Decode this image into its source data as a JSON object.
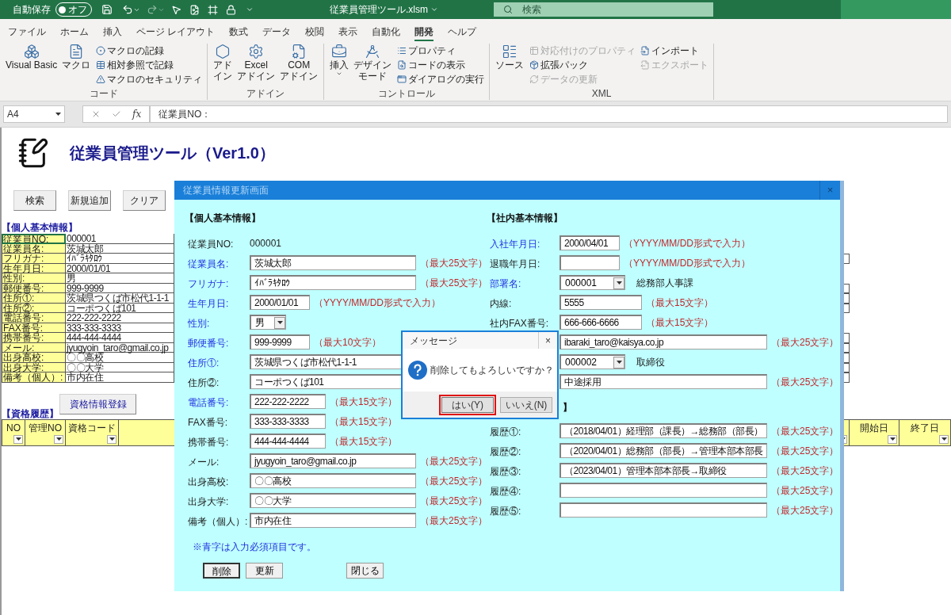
{
  "title_bar": {
    "autosave_label": "自動保存",
    "autosave": {
      "label": "オフ",
      "on": false
    },
    "filename": "従業員管理ツール.xlsm",
    "search_placeholder": "検索"
  },
  "ribbon_tabs": [
    {
      "label": "ファイル",
      "selected": false
    },
    {
      "label": "ホーム",
      "selected": false
    },
    {
      "label": "挿入",
      "selected": false
    },
    {
      "label": "ページ レイアウト",
      "selected": false
    },
    {
      "label": "数式",
      "selected": false
    },
    {
      "label": "データ",
      "selected": false
    },
    {
      "label": "校閲",
      "selected": false
    },
    {
      "label": "表示",
      "selected": false
    },
    {
      "label": "自動化",
      "selected": false
    },
    {
      "label": "開発",
      "selected": true
    },
    {
      "label": "ヘルプ",
      "selected": false
    }
  ],
  "ribbon_groups": [
    {
      "title": "コード",
      "items": [
        {
          "kind": "large",
          "lines": [
            "Visual Basic"
          ]
        },
        {
          "kind": "large",
          "lines": [
            "マクロ"
          ]
        },
        {
          "kind": "stack",
          "items": [
            {
              "label": "マクロの記録",
              "disabled": false
            },
            {
              "label": "相対参照で記録",
              "disabled": false
            },
            {
              "label": "マクロのセキュリティ",
              "disabled": false
            }
          ]
        }
      ]
    },
    {
      "title": "アドイン",
      "items": [
        {
          "kind": "large",
          "lines": [
            "アド",
            "イン"
          ]
        },
        {
          "kind": "large",
          "lines": [
            "Excel",
            "アドイン"
          ]
        },
        {
          "kind": "large",
          "lines": [
            "COM",
            "アドイン"
          ]
        }
      ]
    },
    {
      "title": "コントロール",
      "items": [
        {
          "kind": "large_menu",
          "lines": [
            "挿入"
          ]
        },
        {
          "kind": "large",
          "lines": [
            "デザイン",
            "モード"
          ]
        },
        {
          "kind": "stack",
          "items": [
            {
              "label": "プロパティ",
              "disabled": false
            },
            {
              "label": "コードの表示",
              "disabled": false
            },
            {
              "label": "ダイアログの実行",
              "disabled": false
            }
          ]
        }
      ]
    },
    {
      "title": "XML",
      "items": [
        {
          "kind": "large",
          "lines": [
            "ソース"
          ]
        },
        {
          "kind": "stack",
          "items": [
            {
              "label": "対応付けのプロパティ",
              "disabled": true
            },
            {
              "label": "拡張パック",
              "disabled": false
            },
            {
              "label": "データの更新",
              "disabled": true
            }
          ]
        },
        {
          "kind": "stack",
          "items": [
            {
              "label": "インポート",
              "disabled": false
            },
            {
              "label": "エクスポート",
              "disabled": true
            }
          ]
        }
      ]
    }
  ],
  "formula_bar": {
    "name_box": "A4",
    "fx": "fx",
    "formula": "従業員NO："
  },
  "sheet": {
    "title": "従業員管理ツール（Ver1.0）",
    "buttons": [
      "検索",
      "新規追加",
      "クリア"
    ],
    "personal_title": "【個人基本情報】",
    "personal_rows": [
      {
        "label": "従業員NO:",
        "value": "000001",
        "selected": true
      },
      {
        "label": "従業員名:",
        "value": "茨城太郎",
        "selected": false
      },
      {
        "label": "フリガナ:",
        "value": "ｲﾊﾞﾗｷﾀﾛｳ",
        "selected": false
      },
      {
        "label": "生年月日:",
        "value": "2000/01/01",
        "selected": false
      },
      {
        "label": "性別:",
        "value": "男",
        "selected": false
      },
      {
        "label": "郵便番号:",
        "value": "999-9999",
        "selected": false
      },
      {
        "label": "住所①:",
        "value": "茨城県つくば市松代1-1-1",
        "selected": false
      },
      {
        "label": "住所②:",
        "value": "コーポつくば101",
        "selected": false
      },
      {
        "label": "電話番号:",
        "value": "222-222-2222",
        "selected": false
      },
      {
        "label": "FAX番号:",
        "value": "333-333-3333",
        "selected": false
      },
      {
        "label": "携帯番号:",
        "value": "444-444-4444",
        "selected": false
      },
      {
        "label": "メール:",
        "value": "jyugyoin_taro@gmail.co.jp",
        "selected": false
      },
      {
        "label": "出身高校:",
        "value": "〇〇高校",
        "selected": false
      },
      {
        "label": "出身大学:",
        "value": "〇〇大学",
        "selected": false
      },
      {
        "label": "備考（個人）:",
        "value": "市内在住",
        "selected": false
      }
    ],
    "register_button": "資格情報登録",
    "history_title": "【資格履歴】",
    "history_columns_left": [
      "NO",
      "管理NO",
      "資格コード"
    ],
    "history_columns_right": [
      "開始日",
      "終了日"
    ]
  },
  "dialog": {
    "title": "従業員情報更新画面",
    "close": "×",
    "columns": [
      {
        "sections": [
          {
            "title": "【個人基本情報】",
            "fields": [
              {
                "kind": "static",
                "label": "従業員NO:",
                "value": "000001",
                "required": false
              },
              {
                "kind": "long",
                "label": "従業員名:",
                "value": "茨城太郎",
                "hint": "（最大25文字）",
                "required": true
              },
              {
                "kind": "long",
                "label": "フリガナ:",
                "value": "ｲﾊﾞﾗｷﾀﾛｳ",
                "hint": "（最大25文字）",
                "required": true
              },
              {
                "kind": "short",
                "label": "生年月日:",
                "value": "2000/01/01",
                "hint": "（YYYY/MM/DD形式で入力）",
                "required": true
              },
              {
                "kind": "select_small",
                "label": "性別:",
                "value": "男",
                "required": true
              },
              {
                "kind": "short",
                "label": "郵便番号:",
                "value": "999-9999",
                "hint": "（最大10文字）",
                "required": true
              },
              {
                "kind": "long",
                "label": "住所①:",
                "value": "茨城県つくば市松代1-1-1",
                "required": true
              },
              {
                "kind": "long",
                "label": "住所②:",
                "value": "コーポつくば101",
                "required": false
              },
              {
                "kind": "medium",
                "label": "電話番号:",
                "value": "222-222-2222",
                "hint": "（最大15文字）",
                "required": true
              },
              {
                "kind": "medium",
                "label": "FAX番号:",
                "value": "333-333-3333",
                "hint": "（最大15文字）",
                "required": false
              },
              {
                "kind": "medium",
                "label": "携帯番号:",
                "value": "444-444-4444",
                "hint": "（最大15文字）",
                "required": false
              },
              {
                "kind": "long",
                "label": "メール:",
                "value": "jyugyoin_taro@gmail.co.jp",
                "hint": "（最大25文字）",
                "required": false
              },
              {
                "kind": "long",
                "label": "出身高校:",
                "value": "〇〇高校",
                "hint": "（最大25文字）",
                "required": false
              },
              {
                "kind": "long",
                "label": "出身大学:",
                "value": "〇〇大学",
                "hint": "（最大25文字）",
                "required": false
              },
              {
                "kind": "long",
                "label": "備考（個人）:",
                "value": "市内在住",
                "hint": "（最大25文字）",
                "required": false
              }
            ]
          }
        ],
        "note": "※青字は入力必須項目です。",
        "buttons": [
          {
            "label": "削除",
            "focused": true
          },
          {
            "label": "更新",
            "focused": false
          },
          {
            "label": "閉じる",
            "focused": false
          }
        ]
      },
      {
        "sections": [
          {
            "title": "【社内基本情報】",
            "fields": [
              {
                "kind": "short",
                "label": "入社年月日:",
                "value": "2000/04/01",
                "hint": "（YYYY/MM/DD形式で入力）",
                "required": true
              },
              {
                "kind": "short",
                "label": "退職年月日:",
                "hint": "（YYYY/MM/DD形式で入力）",
                "required": false
              },
              {
                "kind": "select",
                "label": "部署名:",
                "value": "000001",
                "note": "総務部人事課",
                "required": true
              },
              {
                "kind": "medium",
                "label": "内線:",
                "value": "5555",
                "hint": "（最大15文字）",
                "required": false
              },
              {
                "kind": "medium",
                "label": "社内FAX番号:",
                "value": "666-666-6666",
                "hint": "（最大15文字）",
                "required": false
              },
              {
                "kind": "long",
                "value": "ibaraki_taro@kaisya.co.jp",
                "hint": "（最大25文字）"
              },
              {
                "kind": "select",
                "value": "000002",
                "note": "取締役"
              },
              {
                "kind": "long",
                "value": "中途採用",
                "hint": "（最大25文字）"
              }
            ]
          },
          {
            "title": "】",
            "fields": [
              {
                "kind": "long",
                "label": "履歴①:",
                "value": "（2018/04/01）経理部（課長）→総務部（部長）",
                "hint": "（最大25文字）",
                "required": false
              },
              {
                "kind": "long",
                "label": "履歴②:",
                "value": "（2020/04/01）総務部（部長）→管理本部本部長",
                "hint": "（最大25文字）",
                "required": false
              },
              {
                "kind": "long",
                "label": "履歴③:",
                "value": "（2023/04/01）管理本部本部長→取締役",
                "hint": "（最大25文字）",
                "required": false
              },
              {
                "kind": "long",
                "label": "履歴④:",
                "hint": "（最大25文字）",
                "required": false
              },
              {
                "kind": "long",
                "label": "履歴⑤:",
                "hint": "（最大25文字）",
                "required": false
              }
            ]
          }
        ]
      }
    ]
  },
  "message_box": {
    "title": "メッセージ",
    "close": "×",
    "text": "削除してもよろしいですか？",
    "buttons": [
      {
        "label": "はい(Y)",
        "selected": true
      },
      {
        "label": "いいえ(N)",
        "selected": false
      }
    ]
  }
}
